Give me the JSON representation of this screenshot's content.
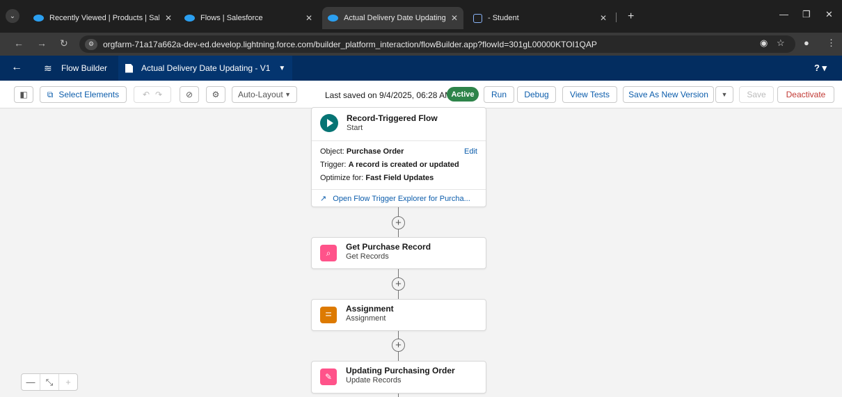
{
  "browser": {
    "tabs": [
      {
        "title": "Recently Viewed | Products | Sal",
        "close": "✕"
      },
      {
        "title": "Flows | Salesforce",
        "close": "✕"
      },
      {
        "title": "Actual Delivery Date Updating",
        "close": "✕"
      },
      {
        "title": "- Student",
        "close": "✕"
      }
    ],
    "new_tab": "+",
    "url": "orgfarm-71a17a662a-dev-ed.develop.lightning.force.com/builder_platform_interaction/flowBuilder.app?flowId=301gL00000KTOI1QAP"
  },
  "header": {
    "app_name": "Flow Builder",
    "flow_tab": "Actual Delivery Date Updating - V1",
    "help": "? ▾"
  },
  "toolbar": {
    "select_elements": "Select Elements",
    "layout_select": "Auto-Layout",
    "last_saved": "Last saved on 9/4/2025, 06:28 AM",
    "status_badge": "Active",
    "run": "Run",
    "debug": "Debug",
    "view_tests": "View Tests",
    "save_as_new": "Save As New Version",
    "save": "Save",
    "deactivate": "Deactivate"
  },
  "canvas": {
    "start": {
      "title": "Record-Triggered Flow",
      "subtitle": "Start",
      "object_label": "Object:",
      "object_value": "Purchase Order",
      "edit": "Edit",
      "trigger_label": "Trigger:",
      "trigger_value": "A record is created or updated",
      "optimize_label": "Optimize for:",
      "optimize_value": "Fast Field Updates",
      "explorer_link": "Open Flow Trigger Explorer for Purcha..."
    },
    "elements": [
      {
        "title": "Get Purchase Record",
        "subtitle": "Get Records",
        "color": "#ff538a"
      },
      {
        "title": "Assignment",
        "subtitle": "Assignment",
        "color": "#dd7a01"
      },
      {
        "title": "Updating Purchasing Order",
        "subtitle": "Update Records",
        "color": "#ff538a"
      }
    ]
  },
  "colors": {
    "header_bg": "#032d60",
    "active_green": "#2e844a",
    "link_blue": "#0b5cab",
    "start_teal": "#067474"
  }
}
